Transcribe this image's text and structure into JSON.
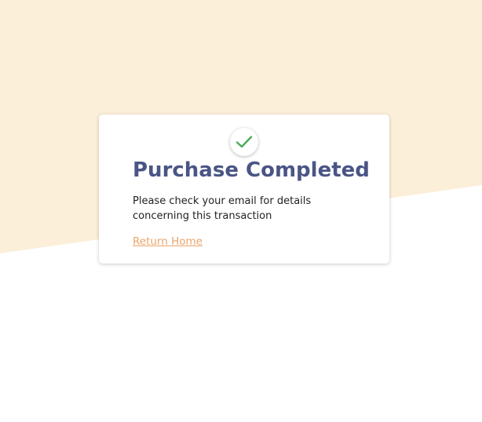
{
  "colors": {
    "background_top": "#fcefd9",
    "background_bottom": "#ffffff",
    "card": "#ffffff",
    "title": "#4a5585",
    "text": "#222222",
    "link": "#eaa46a",
    "check": "#4caa57"
  },
  "card": {
    "icon": "checkmark-icon",
    "title": "Purchase Completed",
    "message": "Please check your email for details concerning this transaction",
    "link_label": "Return Home"
  }
}
